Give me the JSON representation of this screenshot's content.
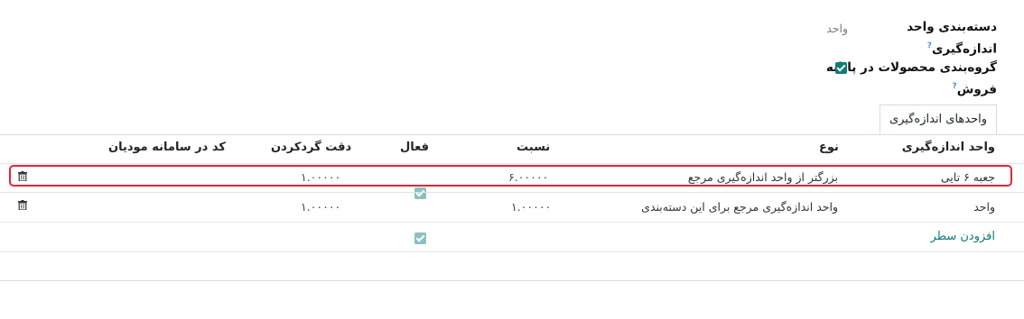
{
  "form": {
    "category_label_line1": "دسته‌بندی واحد",
    "category_label_line2": "اندازه‌گیری",
    "category_value": "واحد",
    "help_mark": "?",
    "group_pos_label_line1": "گروه‌بندی محصولات در پایانه",
    "group_pos_label_line2": "فروش",
    "group_pos_checked": true
  },
  "tab": {
    "label": "واحدهای اندازه‌گیری"
  },
  "table": {
    "headers": {
      "uom": "واحد اندازه‌گیری",
      "type": "نوع",
      "ratio": "نسبت",
      "active": "فعال",
      "rounding": "دقت گردکردن",
      "tax_code": "کد در سامانه مودیان"
    },
    "rows": [
      {
        "uom": "جعبه ۶ تایی",
        "type": "بزرگتر از واحد اندازه‌گیری مرجع",
        "ratio": "۶.۰۰۰۰۰",
        "active": true,
        "rounding": "۱.۰۰۰۰۰",
        "tax_code": ""
      },
      {
        "uom": "واحد",
        "type": "واحد اندازه‌گیری مرجع برای این دسته‌بندی",
        "ratio": "۱.۰۰۰۰۰",
        "active": true,
        "rounding": "۱.۰۰۰۰۰",
        "tax_code": ""
      }
    ],
    "add_line_label": "افزودن سطر"
  },
  "colors": {
    "accent": "#117a7a",
    "highlight": "#e0263b"
  }
}
